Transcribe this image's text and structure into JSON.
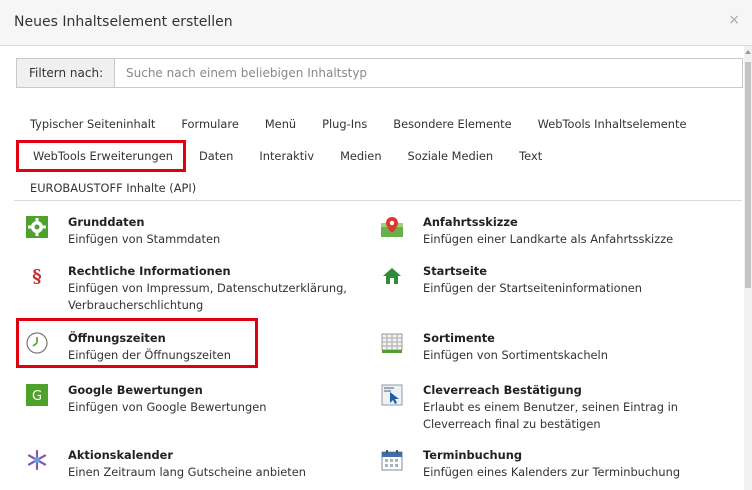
{
  "dialog": {
    "title": "Neues Inhaltselement erstellen",
    "close_label": "×"
  },
  "filter": {
    "label": "Filtern nach:",
    "placeholder": "Suche nach einem beliebigen Inhaltstyp",
    "value": ""
  },
  "tabs": {
    "row1": [
      "Typischer Seiteninhalt",
      "Formulare",
      "Menü",
      "Plug-Ins",
      "Besondere Elemente",
      "WebTools Inhaltselemente"
    ],
    "row2": [
      "WebTools Erweiterungen",
      "Daten",
      "Interaktiv",
      "Medien",
      "Soziale Medien",
      "Text"
    ],
    "row3": [
      "EUROBAUSTOFF Inhalte (API)"
    ]
  },
  "items": {
    "grunddaten": {
      "title": "Grunddaten",
      "desc": "Einfügen von Stammdaten",
      "icon": "gear-icon"
    },
    "anfahrtsskizze": {
      "title": "Anfahrtsskizze",
      "desc": "Einfügen einer Landkarte als Anfahrtsskizze",
      "icon": "map-pin-icon"
    },
    "rechtliche": {
      "title": "Rechtliche Informationen",
      "desc1": "Einfügen von Impressum, Datenschutzerklärung,",
      "desc2": "Verbraucherschlichtung",
      "icon": "paragraph-icon"
    },
    "startseite": {
      "title": "Startseite",
      "desc": "Einfügen der Startseiteninformationen",
      "icon": "home-icon"
    },
    "oeffnungszeiten": {
      "title": "Öffnungszeiten",
      "desc": "Einfügen der Öffnungszeiten",
      "icon": "clock-icon"
    },
    "sortimente": {
      "title": "Sortimente",
      "desc": "Einfügen von Sortimentskacheln",
      "icon": "grid-icon"
    },
    "google": {
      "title": "Google Bewertungen",
      "desc": "Einfügen von Google Bewertungen",
      "icon": "google-icon",
      "icon_letter": "G"
    },
    "cleverreach": {
      "title": "Cleverreach Bestätigung",
      "desc1": "Erlaubt es einem Benutzer, seinen Eintrag in",
      "desc2": "Cleverreach final zu bestätigen",
      "icon": "cursor-click-icon"
    },
    "aktionskalender": {
      "title": "Aktionskalender",
      "desc": "Einen Zeitraum lang Gutscheine anbieten",
      "icon": "snowflake-icon"
    },
    "terminbuchung": {
      "title": "Terminbuchung",
      "desc": "Einfügen eines Kalenders zur Terminbuchung",
      "icon": "calendar-icon"
    }
  },
  "colors": {
    "highlight": "#e1000f",
    "green": "#4ea12a",
    "red": "#c8312f"
  }
}
